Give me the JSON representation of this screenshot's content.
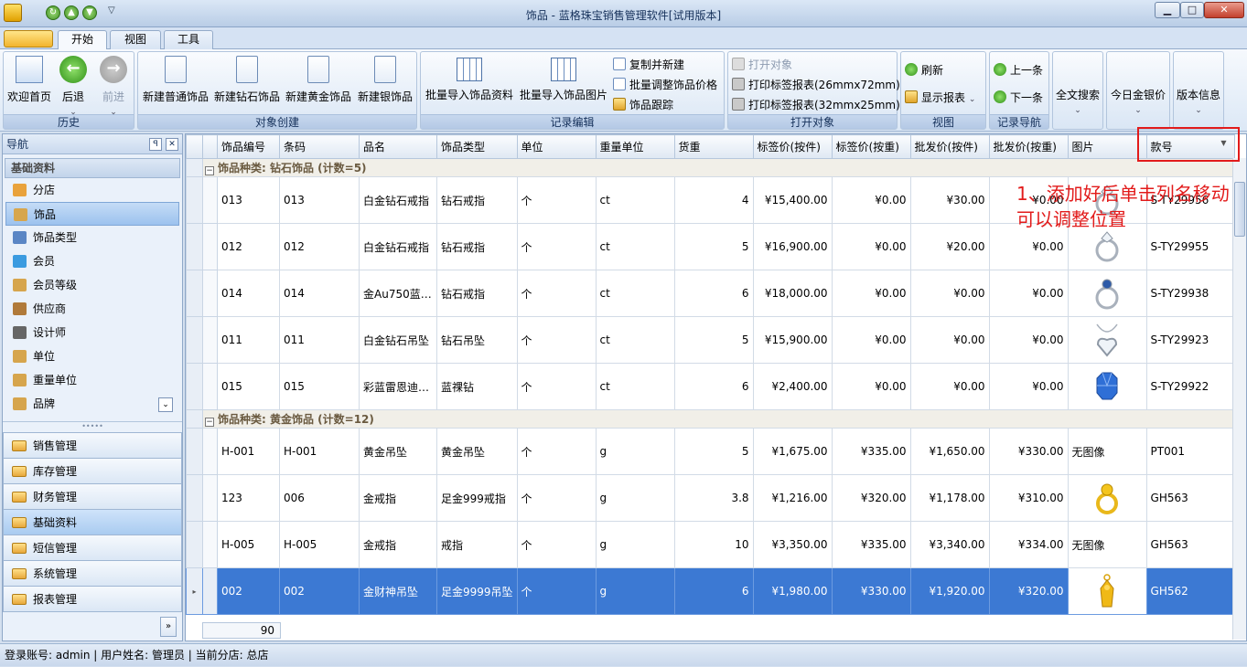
{
  "window": {
    "title": "饰品 - 蓝格珠宝销售管理软件[试用版本]"
  },
  "tabs": [
    {
      "label": "开始"
    },
    {
      "label": "视图"
    },
    {
      "label": "工具"
    }
  ],
  "ribbon": {
    "history": {
      "label": "历史",
      "home": "欢迎首页",
      "back": "后退",
      "forward": "前进"
    },
    "create": {
      "label": "对象创建",
      "b1": "新建普通饰品",
      "b2": "新建钻石饰品",
      "b3": "新建黄金饰品",
      "b4": "新建银饰品"
    },
    "edit": {
      "label": "记录编辑",
      "import1": "批量导入饰品资料",
      "import2": "批量导入饰品图片",
      "copy": "复制并新建",
      "adjust": "批量调整饰品价格",
      "track": "饰品跟踪"
    },
    "open": {
      "label": "打开对象",
      "openobj": "打开对象",
      "print1": "打印标签报表(26mmx72mm)",
      "print2": "打印标签报表(32mmx25mm)"
    },
    "view": {
      "label": "视图",
      "refresh": "刷新",
      "report": "显示报表"
    },
    "nav": {
      "label": "记录导航",
      "prev": "上一条",
      "next": "下一条"
    },
    "search": "全文搜索",
    "gold": "今日金银价",
    "version": "版本信息"
  },
  "nav": {
    "title": "导航",
    "section": "基础资料",
    "items": [
      {
        "label": "分店",
        "icon": "house-icon"
      },
      {
        "label": "饰品",
        "icon": "box-icon"
      },
      {
        "label": "饰品类型",
        "icon": "list-icon"
      },
      {
        "label": "会员",
        "icon": "users-icon"
      },
      {
        "label": "会员等级",
        "icon": "level-icon"
      },
      {
        "label": "供应商",
        "icon": "supplier-icon"
      },
      {
        "label": "设计师",
        "icon": "designer-icon"
      },
      {
        "label": "单位",
        "icon": "unit-icon"
      },
      {
        "label": "重量单位",
        "icon": "weight-icon"
      },
      {
        "label": "品牌",
        "icon": "brand-icon"
      }
    ],
    "categories": [
      {
        "label": "销售管理"
      },
      {
        "label": "库存管理"
      },
      {
        "label": "财务管理"
      },
      {
        "label": "基础资料"
      },
      {
        "label": "短信管理"
      },
      {
        "label": "系统管理"
      },
      {
        "label": "报表管理"
      }
    ]
  },
  "grid": {
    "columns": [
      "饰品编号",
      "条码",
      "品名",
      "饰品类型",
      "单位",
      "重量单位",
      "货重",
      "标签价(按件)",
      "标签价(按重)",
      "批发价(按件)",
      "批发价(按重)",
      "图片",
      "款号"
    ],
    "groups": [
      {
        "label": "饰品种类: 钻石饰品 (计数=5)",
        "rows": [
          {
            "cells": [
              "013",
              "013",
              "白金钻石戒指",
              "钻石戒指",
              "个",
              "ct",
              "4",
              "¥15,400.00",
              "¥0.00",
              "¥30.00",
              "¥0.00",
              "",
              "S-TY29956"
            ],
            "image": "ring"
          },
          {
            "cells": [
              "012",
              "012",
              "白金钻石戒指",
              "钻石戒指",
              "个",
              "ct",
              "5",
              "¥16,900.00",
              "¥0.00",
              "¥20.00",
              "¥0.00",
              "",
              "S-TY29955"
            ],
            "image": "ring"
          },
          {
            "cells": [
              "014",
              "014",
              "金Au750蓝…",
              "钻石戒指",
              "个",
              "ct",
              "6",
              "¥18,000.00",
              "¥0.00",
              "¥0.00",
              "¥0.00",
              "",
              "S-TY29938"
            ],
            "image": "ring-blue"
          },
          {
            "cells": [
              "011",
              "011",
              "白金钻石吊坠",
              "钻石吊坠",
              "个",
              "ct",
              "5",
              "¥15,900.00",
              "¥0.00",
              "¥0.00",
              "¥0.00",
              "",
              "S-TY29923"
            ],
            "image": "pendant"
          },
          {
            "cells": [
              "015",
              "015",
              "彩蓝雷恩迪…",
              "蓝祼钻",
              "个",
              "ct",
              "6",
              "¥2,400.00",
              "¥0.00",
              "¥0.00",
              "¥0.00",
              "",
              "S-TY29922"
            ],
            "image": "blue-gem"
          }
        ]
      },
      {
        "label": "饰品种类: 黄金饰品 (计数=12)",
        "rows": [
          {
            "cells": [
              "H-001",
              "H-001",
              "黄金吊坠",
              "黄金吊坠",
              "个",
              "g",
              "5",
              "¥1,675.00",
              "¥335.00",
              "¥1,650.00",
              "¥330.00",
              "无图像",
              "PT001"
            ],
            "image": ""
          },
          {
            "cells": [
              "123",
              "006",
              "金戒指",
              "足金999戒指",
              "个",
              "g",
              "3.8",
              "¥1,216.00",
              "¥320.00",
              "¥1,178.00",
              "¥310.00",
              "",
              "GH563"
            ],
            "image": "gold-ring"
          },
          {
            "cells": [
              "H-005",
              "H-005",
              "金戒指",
              "戒指",
              "个",
              "g",
              "10",
              "¥3,350.00",
              "¥335.00",
              "¥3,340.00",
              "¥334.00",
              "无图像",
              "GH563"
            ],
            "image": ""
          },
          {
            "cells": [
              "002",
              "002",
              "金财神吊坠",
              "足金9999吊坠",
              "个",
              "g",
              "6",
              "¥1,980.00",
              "¥330.00",
              "¥1,920.00",
              "¥320.00",
              "",
              "GH562"
            ],
            "image": "gold-pendant",
            "selected": true
          }
        ]
      }
    ],
    "footer_value": "90"
  },
  "status": "登录账号: admin  |  用户姓名: 管理员  |  当前分店: 总店",
  "annotation": "1、添加好后单击列名移动可以调整位置"
}
